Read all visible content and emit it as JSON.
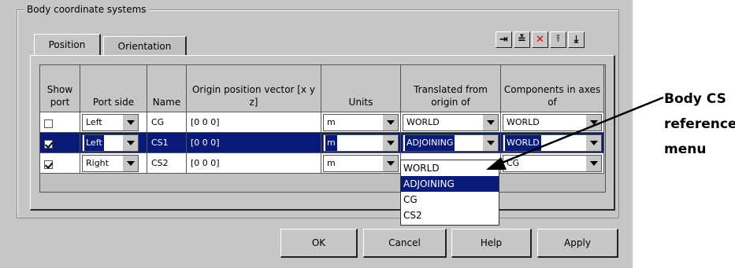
{
  "group_title": "Body coordinate systems",
  "tabs": [
    {
      "label": "Position",
      "active": true
    },
    {
      "label": "Orientation",
      "active": false
    }
  ],
  "toolbar": [
    {
      "icon": "add-icon",
      "glyph": "⇥"
    },
    {
      "icon": "insert-icon",
      "glyph": "≚"
    },
    {
      "icon": "delete-icon",
      "glyph": "✕",
      "color": "#e00000"
    },
    {
      "icon": "move-up-icon",
      "glyph": "⭱"
    },
    {
      "icon": "move-down-icon",
      "glyph": "⤓"
    }
  ],
  "table": {
    "headers": {
      "show_port": "Show port",
      "port_side": "Port side",
      "name": "Name",
      "origin": "Origin position vector [x y z]",
      "units": "Units",
      "translated": "Translated from origin of",
      "components": "Components in axes of"
    },
    "rows": [
      {
        "show_port": false,
        "port_side": "Left",
        "name": "CG",
        "origin": "[0 0 0]",
        "units": "m",
        "translated": "WORLD",
        "components": "WORLD",
        "selected": false
      },
      {
        "show_port": true,
        "port_side": "Left",
        "name": "CS1",
        "origin": "[0 0 0]",
        "units": "m",
        "translated": "ADJOINING",
        "components": "WORLD",
        "selected": true
      },
      {
        "show_port": true,
        "port_side": "Right",
        "name": "CS2",
        "origin": "[0 0 0]",
        "units": "m",
        "translated": "",
        "components": "CG",
        "selected": false
      }
    ]
  },
  "dropdown": {
    "items": [
      "WORLD",
      "ADJOINING",
      "CG",
      "CS2"
    ],
    "highlighted": "ADJOINING"
  },
  "buttons": {
    "ok": "OK",
    "cancel": "Cancel",
    "help": "Help",
    "apply": "Apply"
  },
  "annotation": {
    "line1": "Body CS",
    "line2": "reference",
    "line3": "menu"
  },
  "colors": {
    "dialog_bg": "#c6c6c6",
    "selection": "#0a1a78",
    "delete_red": "#e00000"
  }
}
